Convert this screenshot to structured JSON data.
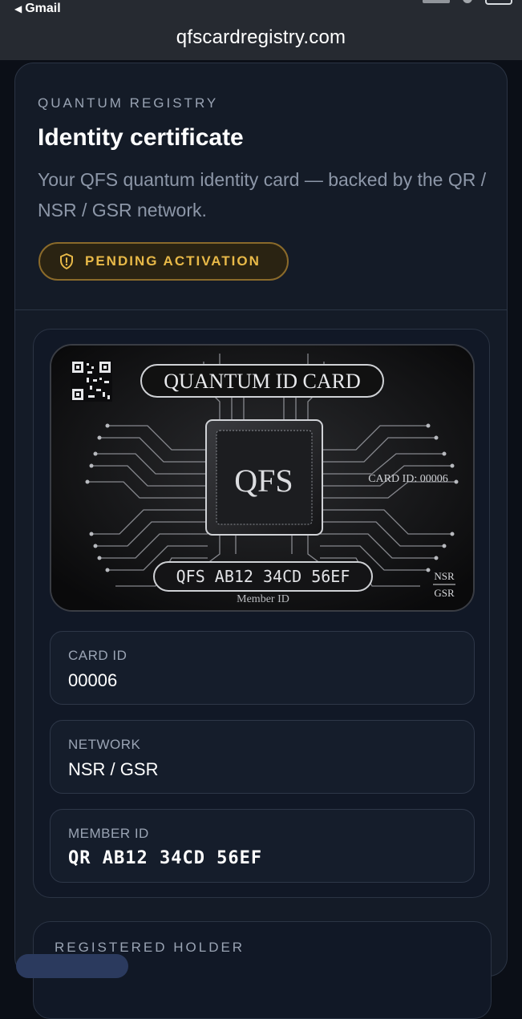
{
  "status_bar": {
    "back_label": "Gmail",
    "back_chevron": "◀"
  },
  "url_bar": {
    "url": "qfscardregistry.com"
  },
  "header": {
    "kicker": "QUANTUM REGISTRY",
    "title": "Identity certificate",
    "description": "Your QFS quantum identity card — backed by the QR / NSR / GSR network.",
    "badge": {
      "label": "PENDING ACTIVATION",
      "icon": "shield-alert-icon",
      "color": "#e8b948"
    }
  },
  "card_image": {
    "header_text": "QUANTUM ID CARD",
    "chip_text": "QFS",
    "card_id_text": "CARD ID: 00006",
    "member_code": "QFS AB12 34CD 56EF",
    "member_label": "Member ID",
    "network_top": "NSR",
    "network_bottom": "GSR"
  },
  "fields": [
    {
      "label": "CARD ID",
      "value": "00006"
    },
    {
      "label": "NETWORK",
      "value": "NSR / GSR"
    },
    {
      "label": "MEMBER ID",
      "value": "QR AB12 34CD 56EF"
    }
  ],
  "lower_section": {
    "label": "REGISTERED HOLDER"
  },
  "colors": {
    "background": "#0b0f17",
    "panel": "#141b27",
    "accent": "#e8b948"
  }
}
